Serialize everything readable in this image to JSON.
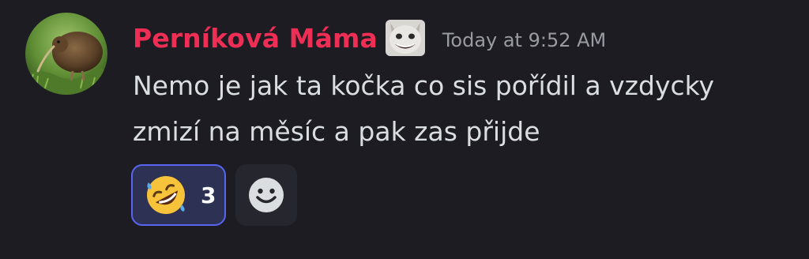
{
  "message": {
    "author": "Perníková Máma",
    "timestamp": "Today at 9:52 AM",
    "content": "Nemo je jak ta kočka co sis pořídil a vzdycky zmizí na měsíc a pak zas přijde",
    "avatar_icon": "kiwi-bird-avatar",
    "role_icon": "cat-face-icon"
  },
  "reactions": [
    {
      "emoji_icon": "rolling-on-floor-laughing-icon",
      "count": "3",
      "active": true
    }
  ],
  "add_reaction": {
    "icon": "smiley-face-icon"
  },
  "colors": {
    "background": "#1c1c22",
    "username": "#ee2e54",
    "text": "#dbdee1",
    "timestamp": "#9a9ba2",
    "reaction_active_bg": "#2d3153",
    "reaction_active_border": "#5865f2"
  }
}
